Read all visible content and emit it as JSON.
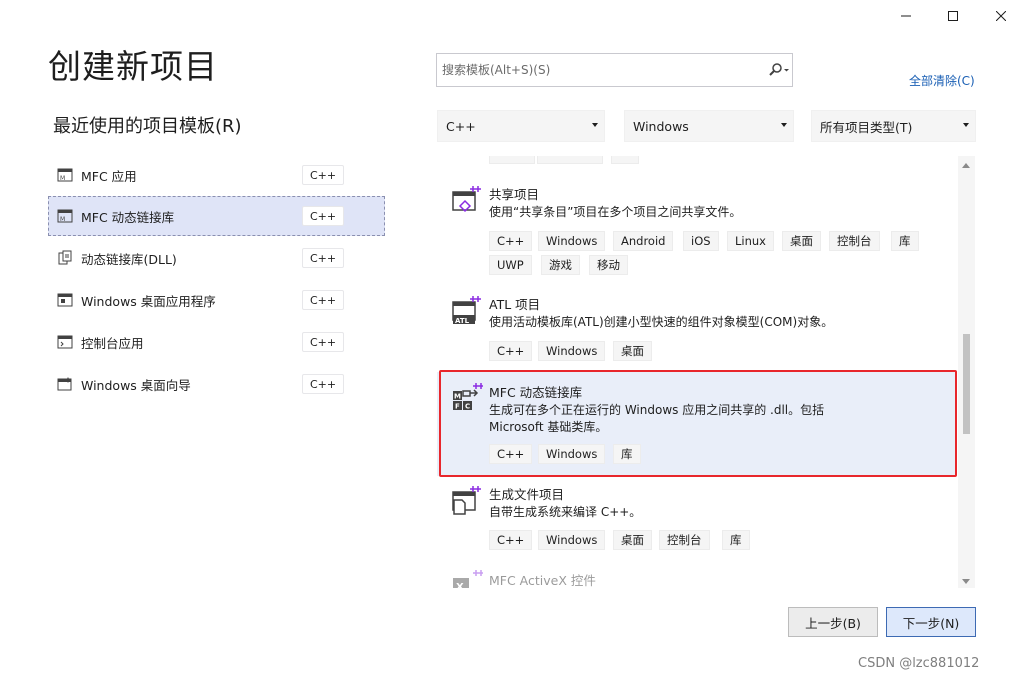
{
  "window": {
    "controls": [
      "minimize-icon",
      "maximize-icon",
      "close-icon"
    ]
  },
  "page_title": "创建新项目",
  "recent": {
    "title": "最近使用的项目模板(R)",
    "items": [
      {
        "label": "MFC 应用",
        "lang": "C++",
        "icon": "mfc-app-icon",
        "selected": false
      },
      {
        "label": "MFC 动态链接库",
        "lang": "C++",
        "icon": "mfc-dll-icon",
        "selected": true
      },
      {
        "label": "动态链接库(DLL)",
        "lang": "C++",
        "icon": "dll-icon",
        "selected": false
      },
      {
        "label": "Windows 桌面应用程序",
        "lang": "C++",
        "icon": "desktop-app-icon",
        "selected": false
      },
      {
        "label": "控制台应用",
        "lang": "C++",
        "icon": "console-app-icon",
        "selected": false
      },
      {
        "label": "Windows 桌面向导",
        "lang": "C++",
        "icon": "desktop-wizard-icon",
        "selected": false
      }
    ]
  },
  "search": {
    "placeholder": "搜索模板(Alt+S)(S)",
    "value": ""
  },
  "clear_all": "全部清除(C)",
  "filters": {
    "language": "C++",
    "platform": "Windows",
    "project_type": "所有项目类型(T)"
  },
  "templates": [
    {
      "name": "共享项目",
      "description": [
        "使用“共享条目”项目在多个项目之间共享文件。"
      ],
      "tags": [
        "C++",
        "Windows",
        "Android",
        "iOS",
        "Linux",
        "桌面",
        "控制台",
        "库",
        "UWP",
        "游戏",
        "移动"
      ],
      "icon": "shared-project-icon"
    },
    {
      "name": "ATL 项目",
      "description": [
        "使用活动模板库(ATL)创建小型快速的组件对象模型(COM)对象。"
      ],
      "tags": [
        "C++",
        "Windows",
        "桌面"
      ],
      "icon": "atl-project-icon"
    },
    {
      "name": "MFC 动态链接库",
      "description": [
        "生成可在多个正在运行的 Windows 应用之间共享的 .dll。包括",
        "Microsoft 基础类库。"
      ],
      "tags": [
        "C++",
        "Windows",
        "库"
      ],
      "icon": "mfc-dll-template-icon",
      "selected": true
    },
    {
      "name": "生成文件项目",
      "description": [
        "自带生成系统来编译 C++。"
      ],
      "tags": [
        "C++",
        "Windows",
        "桌面",
        "控制台",
        "库"
      ],
      "icon": "makefile-project-icon"
    },
    {
      "name": "MFC ActiveX 控件",
      "description": [],
      "tags": [],
      "icon": "mfc-activex-icon"
    }
  ],
  "buttons": {
    "back": "上一步(B)",
    "next": "下一步(N)"
  },
  "watermark": "CSDN @lzc881012",
  "colors": {
    "selection": "#dfe4f7",
    "highlight_border": "#e8262c",
    "link": "#1a5fb4",
    "accent_purple": "#8a2be2"
  }
}
